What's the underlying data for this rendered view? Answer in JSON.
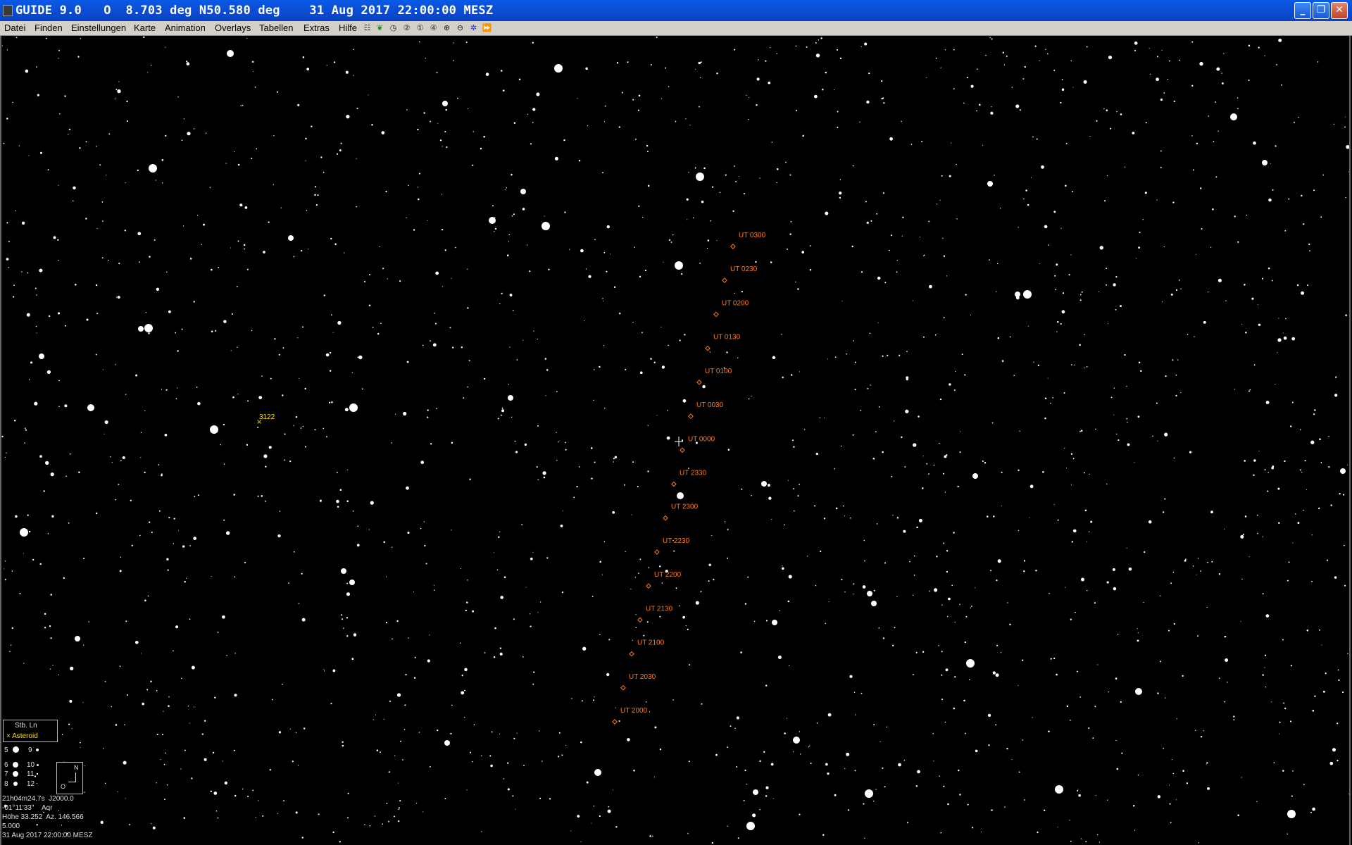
{
  "titlebar": {
    "title": "GUIDE 9.0   O  8.703 deg N50.580 deg    31 Aug 2017 22:00:00 MESZ",
    "minimize": "_",
    "restore": "❐",
    "close": "✕"
  },
  "menu": {
    "items": [
      "Datei",
      "Finden",
      "Einstellungen",
      "Karte",
      "Animation",
      "Overlays",
      "Tabellen",
      "Extras",
      "Hilfe"
    ]
  },
  "toolbar": {
    "icons": [
      "grid-icon",
      "leaf-icon",
      "clock-icon",
      "zoom-2-icon",
      "zoom-1-icon",
      "zoom-4-icon",
      "zoom-in-icon",
      "zoom-out-icon",
      "star-icon",
      "fast-forward-icon"
    ]
  },
  "chart": {
    "track_color": "#ff7a1a",
    "asteroid_color": "#ffe000",
    "star_color": "#ffffff",
    "track_labels": [
      "UT 0300",
      "UT 0230",
      "UT 0200",
      "UT 0130",
      "UT 0100",
      "UT 0030",
      "UT 0000",
      "UT 2330",
      "UT 2300",
      "UT 2230",
      "UT 2200",
      "UT 2130",
      "UT 2100",
      "UT 2030",
      "UT 2000"
    ],
    "asteroid_label": "3122"
  },
  "legend": {
    "title": "Stb. Ln",
    "asteroid_label": "× Asteroid",
    "mags": [
      "5",
      "6",
      "7",
      "8",
      "9",
      "10",
      "11",
      "12"
    ]
  },
  "compass": {
    "north": "N",
    "east": "O"
  },
  "info": {
    "ra": "21h04m24.7s  J2000.0",
    "dec": "-01°11'33\"    Aqr",
    "altaz": "Höhe 33.252  Az. 146.566",
    "fov": "5.000",
    "date": "31 Aug 2017 22:00:00 MESZ"
  }
}
